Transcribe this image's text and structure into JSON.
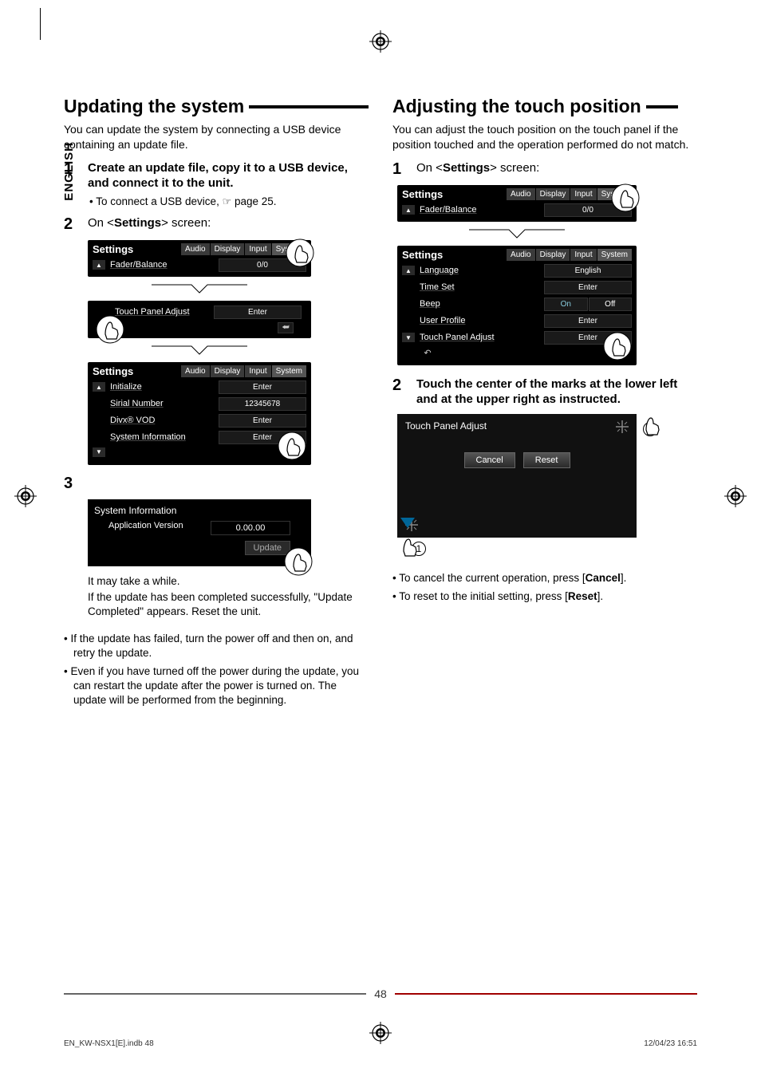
{
  "language_tab": "ENGLISH",
  "left": {
    "heading": "Updating the system",
    "intro": "You can update the system by connecting a USB device containing an update file.",
    "step1": {
      "num": "1",
      "title_a": "Create an update file, copy it to a USB device, and connect it to the unit.",
      "sub": "To connect a USB device, ",
      "sub_ref": " page 25."
    },
    "step2": {
      "num": "2",
      "text_pre": "On <",
      "text_b": "Settings",
      "text_post": "> screen:"
    },
    "ss1": {
      "title": "Settings",
      "tabs": [
        "Audio",
        "Display",
        "Input",
        "System"
      ],
      "row1_label": "Fader/Balance",
      "row1_value": "0/0"
    },
    "ss_mid": {
      "row_label": "Touch Panel Adjust",
      "row_value": "Enter"
    },
    "ss2": {
      "title": "Settings",
      "tabs": [
        "Audio",
        "Display",
        "Input",
        "System"
      ],
      "rows": [
        {
          "label": "Initialize",
          "value": "Enter"
        },
        {
          "label": "Sirial Number",
          "value": "12345678"
        },
        {
          "label": "Divx® VOD",
          "value": "Enter"
        },
        {
          "label": "System Information",
          "value": "Enter"
        }
      ]
    },
    "step3": {
      "num": "3"
    },
    "sysinfo": {
      "title": "System Information",
      "row_label": "Application Version",
      "row_value": "0.00.00",
      "btn": "Update"
    },
    "caption1": "It may take a while.",
    "caption2": "If the update has been completed successfully, \"Update Completed\" appears. Reset the unit.",
    "bullet1": "If the update has failed, turn the power off and then on, and retry the update.",
    "bullet2": "Even if you have turned off the power during the update, you can restart the update after the power is turned on. The update will be performed from the beginning."
  },
  "right": {
    "heading": "Adjusting the touch position",
    "intro": "You can adjust the touch position on the touch panel if the position touched and the operation performed do not match.",
    "step1": {
      "num": "1",
      "text_pre": "On <",
      "text_b": "Settings",
      "text_post": "> screen:"
    },
    "ss1": {
      "title": "Settings",
      "tabs": [
        "Audio",
        "Display",
        "Input",
        "System"
      ],
      "row1_label": "Fader/Balance",
      "row1_value": "0/0"
    },
    "ss2": {
      "title": "Settings",
      "tabs": [
        "Audio",
        "Display",
        "Input",
        "System"
      ],
      "rows": [
        {
          "label": "Language",
          "value": "English"
        },
        {
          "label": "Time Set",
          "value": "Enter"
        },
        {
          "label": "Beep",
          "on": "On",
          "off": "Off"
        },
        {
          "label": "User Profile",
          "value": "Enter"
        },
        {
          "label": "Touch Panel Adjust",
          "value": "Enter"
        }
      ]
    },
    "step2": {
      "num": "2",
      "title": "Touch the center of the marks at the lower left and at the upper right as instructed."
    },
    "touch_adjust": {
      "title": "Touch Panel Adjust",
      "cancel": "Cancel",
      "reset": "Reset"
    },
    "bullet1_pre": "To cancel the current operation, press [",
    "bullet1_b": "Cancel",
    "bullet1_post": "].",
    "bullet2_pre": "To reset to the initial setting, press [",
    "bullet2_b": "Reset",
    "bullet2_post": "]."
  },
  "page_number": "48",
  "footer_left": "EN_KW-NSX1[E].indb   48",
  "footer_right": "12/04/23   16:51"
}
